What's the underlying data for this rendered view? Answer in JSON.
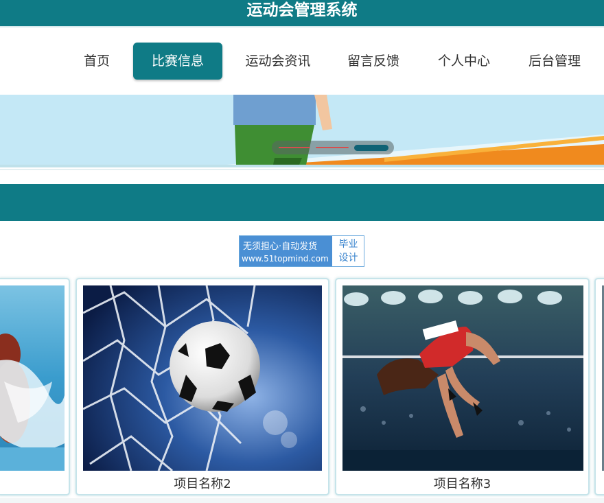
{
  "header": {
    "title": "运动会管理系统"
  },
  "nav": {
    "items": [
      {
        "label": "首页",
        "active": false
      },
      {
        "label": "比赛信息",
        "active": true
      },
      {
        "label": "运动会资讯",
        "active": false
      },
      {
        "label": "留言反馈",
        "active": false
      },
      {
        "label": "个人中心",
        "active": false
      },
      {
        "label": "后台管理",
        "active": false
      }
    ]
  },
  "banner": {
    "slide_count": 3,
    "active_slide": 3
  },
  "ad": {
    "line1": "无须担心·自动发货",
    "line2": "www.51topmind.com",
    "tag1": "毕业",
    "tag2": "设计"
  },
  "projects": [
    {
      "label": "",
      "image": "swimming-photo"
    },
    {
      "label": "项目名称2",
      "image": "soccer-ball-net-photo"
    },
    {
      "label": "项目名称3",
      "image": "high-jump-photo"
    }
  ],
  "colors": {
    "primary": "#0f7b86",
    "ad_blue": "#4a8fd4"
  }
}
